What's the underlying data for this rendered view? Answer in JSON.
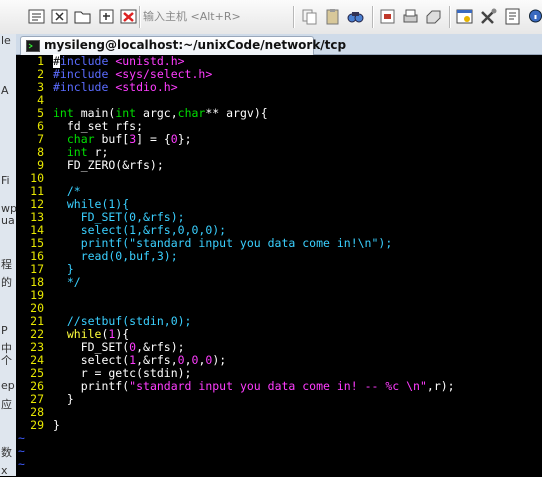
{
  "toolbar": {
    "host_placeholder": "输入主机 <Alt+R>",
    "icons": [
      "new-connection-icon",
      "quick-connect-icon",
      "open-folder-icon",
      "reconnect-icon",
      "disconnect-icon",
      "copy-icon",
      "paste-icon",
      "find-icon",
      "print-setup-icon",
      "print-icon",
      "properties-icon",
      "tools-icon",
      "help-icon",
      "about-icon"
    ]
  },
  "left_strip": [
    "le",
    "A",
    "Fi",
    "wp",
    "ua",
    "程",
    "的",
    "P",
    "中",
    "个",
    "ep",
    "应",
    "数",
    "x"
  ],
  "tab": {
    "title": "mysileng@localhost:~/unixCode/network/tcp"
  },
  "editor": {
    "colors": {
      "line_number": "#e8e800",
      "preprocessor": "#5b6cff",
      "string": "#ff3dff",
      "comment": "#3ad0ff",
      "type": "#00e000",
      "keyword": "#ffff3c",
      "tilde": "#3d5bff"
    },
    "lines": [
      {
        "n": "1",
        "segs": [
          [
            "cur",
            "#"
          ],
          [
            "prep",
            "include "
          ],
          [
            "inc",
            "<unistd.h>"
          ]
        ]
      },
      {
        "n": "2",
        "segs": [
          [
            "prep",
            "#include "
          ],
          [
            "inc",
            "<sys/select.h>"
          ]
        ]
      },
      {
        "n": "3",
        "segs": [
          [
            "prep",
            "#include "
          ],
          [
            "inc",
            "<stdio.h>"
          ]
        ]
      },
      {
        "n": "4",
        "segs": []
      },
      {
        "n": "5",
        "segs": [
          [
            "type",
            "int"
          ],
          [
            "plain",
            " main("
          ],
          [
            "type",
            "int"
          ],
          [
            "plain",
            " argc,"
          ],
          [
            "type",
            "char"
          ],
          [
            "plain",
            "** argv){"
          ]
        ]
      },
      {
        "n": "6",
        "segs": [
          [
            "plain",
            "  fd_set rfs;"
          ]
        ]
      },
      {
        "n": "7",
        "segs": [
          [
            "plain",
            "  "
          ],
          [
            "type",
            "char"
          ],
          [
            "plain",
            " buf["
          ],
          [
            "num",
            "3"
          ],
          [
            "plain",
            "] = {"
          ],
          [
            "num",
            "0"
          ],
          [
            "plain",
            "};"
          ]
        ]
      },
      {
        "n": "8",
        "segs": [
          [
            "plain",
            "  "
          ],
          [
            "type",
            "int"
          ],
          [
            "plain",
            " r;"
          ]
        ]
      },
      {
        "n": "9",
        "segs": [
          [
            "plain",
            "  FD_ZERO(&rfs);"
          ]
        ]
      },
      {
        "n": "10",
        "segs": []
      },
      {
        "n": "11",
        "segs": [
          [
            "cmt",
            "  /*"
          ]
        ]
      },
      {
        "n": "12",
        "segs": [
          [
            "cmt",
            "  while(1){"
          ]
        ]
      },
      {
        "n": "13",
        "segs": [
          [
            "cmt",
            "    FD_SET(0,&rfs);"
          ]
        ]
      },
      {
        "n": "14",
        "segs": [
          [
            "cmt",
            "    select(1,&rfs,0,0,0);"
          ]
        ]
      },
      {
        "n": "15",
        "segs": [
          [
            "cmt",
            "    printf(\"standard input you data come in!\\n\");"
          ]
        ]
      },
      {
        "n": "16",
        "segs": [
          [
            "cmt",
            "    read(0,buf,3);"
          ]
        ]
      },
      {
        "n": "17",
        "segs": [
          [
            "cmt",
            "  }"
          ]
        ]
      },
      {
        "n": "18",
        "segs": [
          [
            "cmt",
            "  */"
          ]
        ]
      },
      {
        "n": "19",
        "segs": []
      },
      {
        "n": "20",
        "segs": []
      },
      {
        "n": "21",
        "segs": [
          [
            "cmt",
            "  //setbuf(stdin,0);"
          ]
        ]
      },
      {
        "n": "22",
        "segs": [
          [
            "plain",
            "  "
          ],
          [
            "kw",
            "while"
          ],
          [
            "plain",
            "("
          ],
          [
            "num",
            "1"
          ],
          [
            "plain",
            "){"
          ]
        ]
      },
      {
        "n": "23",
        "segs": [
          [
            "plain",
            "    FD_SET("
          ],
          [
            "num",
            "0"
          ],
          [
            "plain",
            ",&rfs);"
          ]
        ]
      },
      {
        "n": "24",
        "segs": [
          [
            "plain",
            "    select("
          ],
          [
            "num",
            "1"
          ],
          [
            "plain",
            ",&rfs,"
          ],
          [
            "num",
            "0"
          ],
          [
            "plain",
            ","
          ],
          [
            "num",
            "0"
          ],
          [
            "plain",
            ","
          ],
          [
            "num",
            "0"
          ],
          [
            "plain",
            ");"
          ]
        ]
      },
      {
        "n": "25",
        "segs": [
          [
            "plain",
            "    r = getc(stdin);"
          ]
        ]
      },
      {
        "n": "26",
        "segs": [
          [
            "plain",
            "    printf("
          ],
          [
            "str",
            "\"standard input you data come in! -- %c \\n\""
          ],
          [
            "plain",
            ",r);"
          ]
        ]
      },
      {
        "n": "27",
        "segs": [
          [
            "plain",
            "  }"
          ]
        ]
      },
      {
        "n": "28",
        "segs": []
      },
      {
        "n": "29",
        "segs": [
          [
            "plain",
            "}"
          ]
        ]
      }
    ],
    "tildes": [
      "~",
      "~",
      "~"
    ]
  }
}
